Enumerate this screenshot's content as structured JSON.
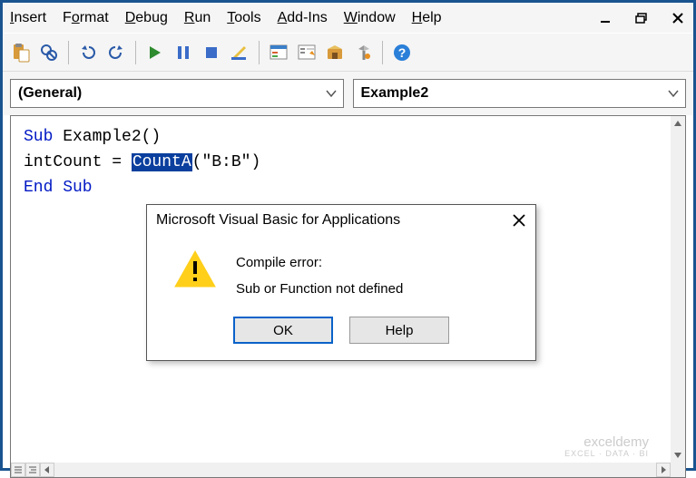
{
  "menu": {
    "insert": "Insert",
    "format": "Format",
    "debug": "Debug",
    "run": "Run",
    "tools": "Tools",
    "addins": "Add-Ins",
    "window": "Window",
    "help": "Help"
  },
  "dropdowns": {
    "left": "(General)",
    "right": "Example2"
  },
  "code": {
    "kw_sub": "Sub",
    "subname": " Example2()",
    "line2_pre": "intCount = ",
    "line2_sel": "CountA",
    "line2_post": "(\"B:B\")",
    "kw_end": "End Sub"
  },
  "dialog": {
    "title": "Microsoft Visual Basic for Applications",
    "line1": "Compile error:",
    "line2": "Sub or Function not defined",
    "ok": "OK",
    "help": "Help"
  },
  "watermark": {
    "main": "exceldemy",
    "sub": "EXCEL · DATA · BI"
  }
}
